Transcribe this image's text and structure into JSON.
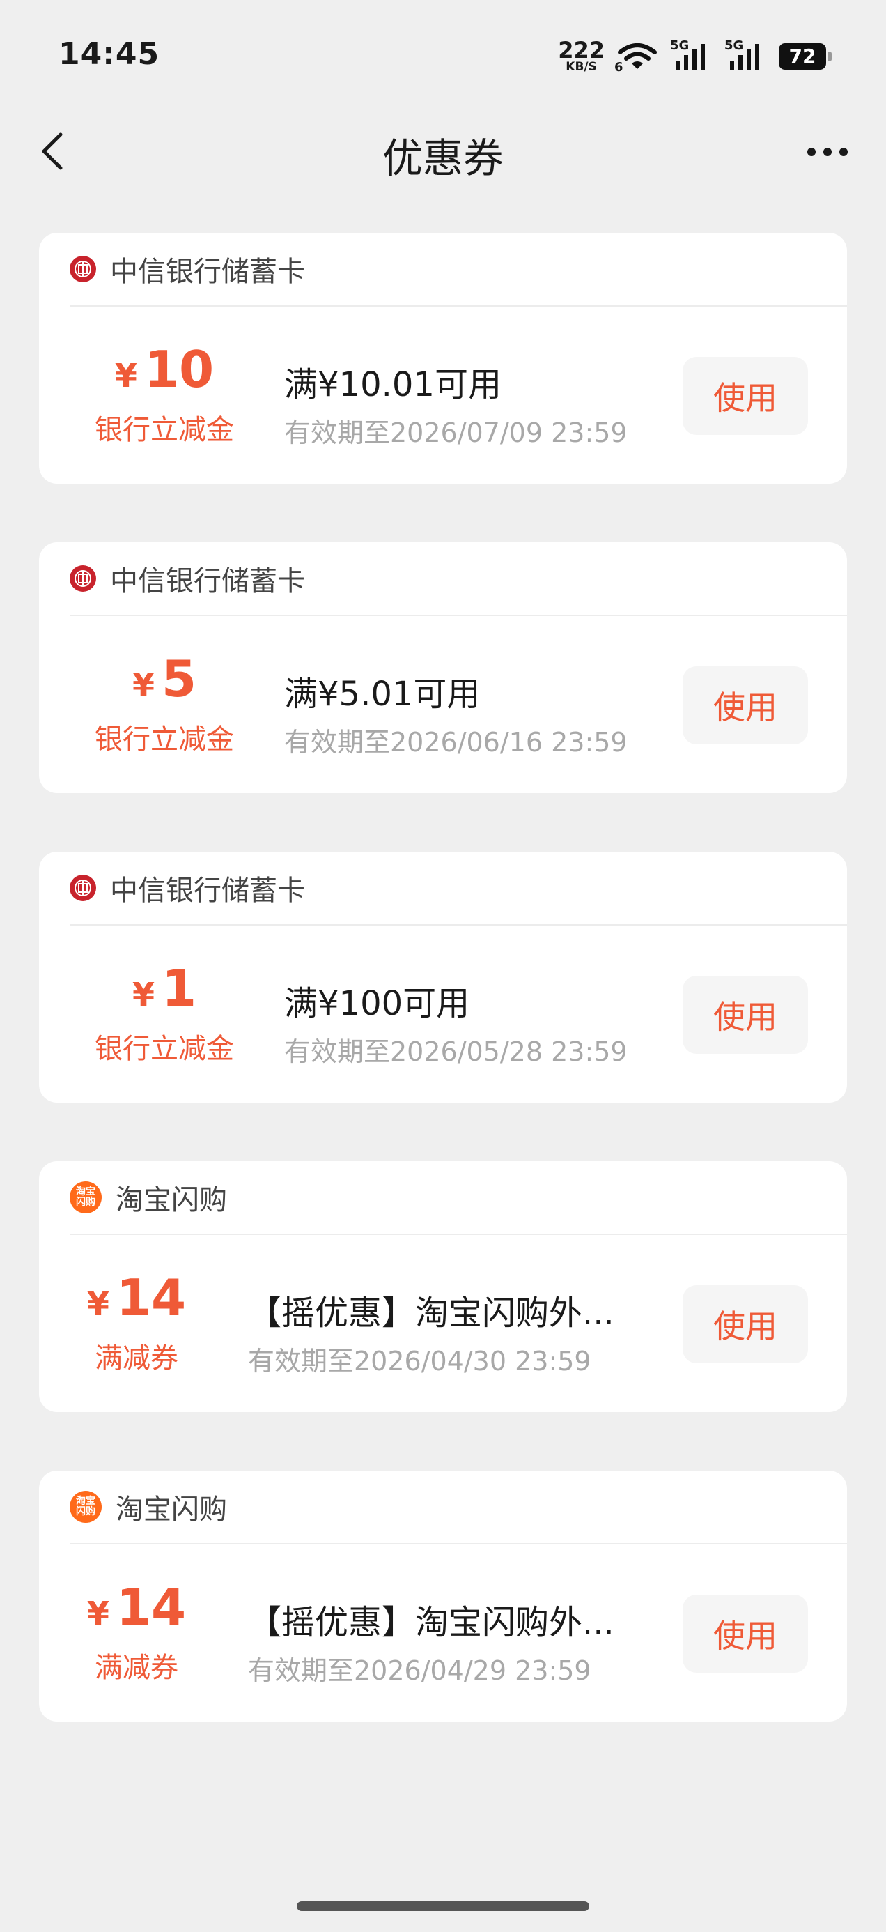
{
  "status_bar": {
    "time": "14:45",
    "net_speed": "222",
    "net_unit": "KB/S",
    "wifi_sub": "6",
    "sim1": "5G",
    "sim2": "5G",
    "battery": "72"
  },
  "nav": {
    "title": "优惠券"
  },
  "coupons": [
    {
      "brand": "中信银行储蓄卡",
      "logo": "citic",
      "currency": "¥",
      "amount": "10",
      "type": "银行立减金",
      "title": "满¥10.01可用",
      "expiry": "有效期至2026/07/09 23:59",
      "button": "使用"
    },
    {
      "brand": "中信银行储蓄卡",
      "logo": "citic",
      "currency": "¥",
      "amount": "5",
      "type": "银行立减金",
      "title": "满¥5.01可用",
      "expiry": "有效期至2026/06/16 23:59",
      "button": "使用"
    },
    {
      "brand": "中信银行储蓄卡",
      "logo": "citic",
      "currency": "¥",
      "amount": "1",
      "type": "银行立减金",
      "title": "满¥100可用",
      "expiry": "有效期至2026/05/28 23:59",
      "button": "使用"
    },
    {
      "brand": "淘宝闪购",
      "logo": "taobao",
      "logo_text_1": "淘宝",
      "logo_text_2": "闪购",
      "currency": "¥",
      "amount": "14",
      "type": "满减券",
      "title": "【摇优惠】淘宝闪购外...",
      "expiry": "有效期至2026/04/30 23:59",
      "button": "使用"
    },
    {
      "brand": "淘宝闪购",
      "logo": "taobao",
      "logo_text_1": "淘宝",
      "logo_text_2": "闪购",
      "currency": "¥",
      "amount": "14",
      "type": "满减券",
      "title": "【摇优惠】淘宝闪购外...",
      "expiry": "有效期至2026/04/29 23:59",
      "button": "使用"
    }
  ],
  "colors": {
    "accent": "#ef5a37",
    "background": "#efefef",
    "citic_red": "#c8232c",
    "taobao_orange": "#ff6a1a"
  }
}
